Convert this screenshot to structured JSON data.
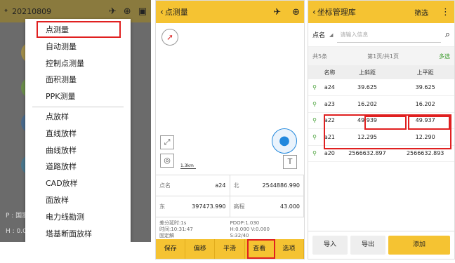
{
  "panel1": {
    "date": "20210809",
    "bg_left": [
      "P : 国家",
      "H : 0.0"
    ],
    "menu": [
      "点测量",
      "自动测量",
      "控制点测量",
      "面积测量",
      "PPK测量",
      "点放样",
      "直线放样",
      "曲线放样",
      "道路放样",
      "CAD放样",
      "面放样",
      "电力线勘测",
      "塔基断面放样"
    ]
  },
  "panel2": {
    "title": "点测量",
    "scale": "1.3km",
    "fields": [
      {
        "label": "点名",
        "value": "a24"
      },
      {
        "label": "北",
        "value": "2544886.990"
      },
      {
        "label": "东",
        "value": "397473.990"
      },
      {
        "label": "高程",
        "value": "43.000"
      }
    ],
    "status_left": [
      "差分延时:1s",
      "时间:10:31:47",
      "固定解"
    ],
    "status_right": [
      "PDOP:1.030",
      "H:0.000  V:0.000",
      "S:32/40"
    ],
    "buttons": [
      "保存",
      "偏移",
      "平滑",
      "查看",
      "选项"
    ]
  },
  "panel3": {
    "title": "坐标管理库",
    "filter": "筛选",
    "search_label": "点名",
    "search_placeholder": "请输入信息",
    "count": "共5条",
    "page": "第1页/共1页",
    "multi": "多选",
    "headers": [
      "名称",
      "上斜距",
      "上平距"
    ],
    "rows": [
      [
        "a24",
        "39.625",
        "39.625"
      ],
      [
        "a23",
        "16.202",
        "16.202"
      ],
      [
        "a22",
        "49.939",
        "49.937"
      ],
      [
        "a21",
        "12.295",
        "12.290"
      ],
      [
        "a20",
        "2566632.897",
        "2566632.893"
      ]
    ],
    "footer": [
      "导入",
      "导出",
      "添加"
    ]
  },
  "colors": {
    "header": "#f5c332",
    "accent": "#2288dd",
    "highlight": "#e02020"
  }
}
